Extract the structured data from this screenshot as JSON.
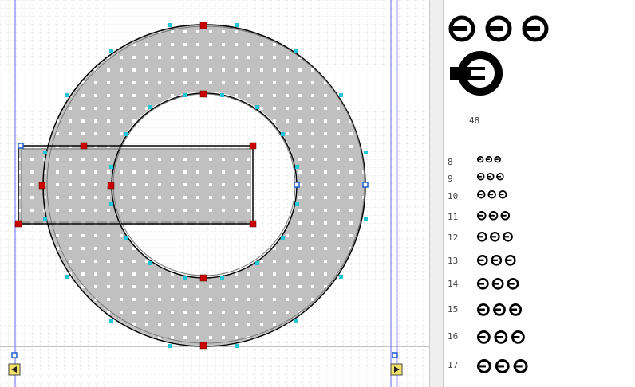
{
  "editor": {
    "grid_color": "#d4d4d4",
    "glyph_fill": "#c0c0c0",
    "on_curve_point_color": "#cc0000",
    "off_curve_point_color": "#22c4d8",
    "blue_point_color": "#1e5fd0",
    "guide_color": "#6666ff",
    "metric_marker_color": "#f3e26a"
  },
  "preview": {
    "big_size_label": "48",
    "sizes": [
      "8",
      "9",
      "10",
      "11",
      "12",
      "13",
      "14",
      "15",
      "16",
      "17"
    ]
  }
}
